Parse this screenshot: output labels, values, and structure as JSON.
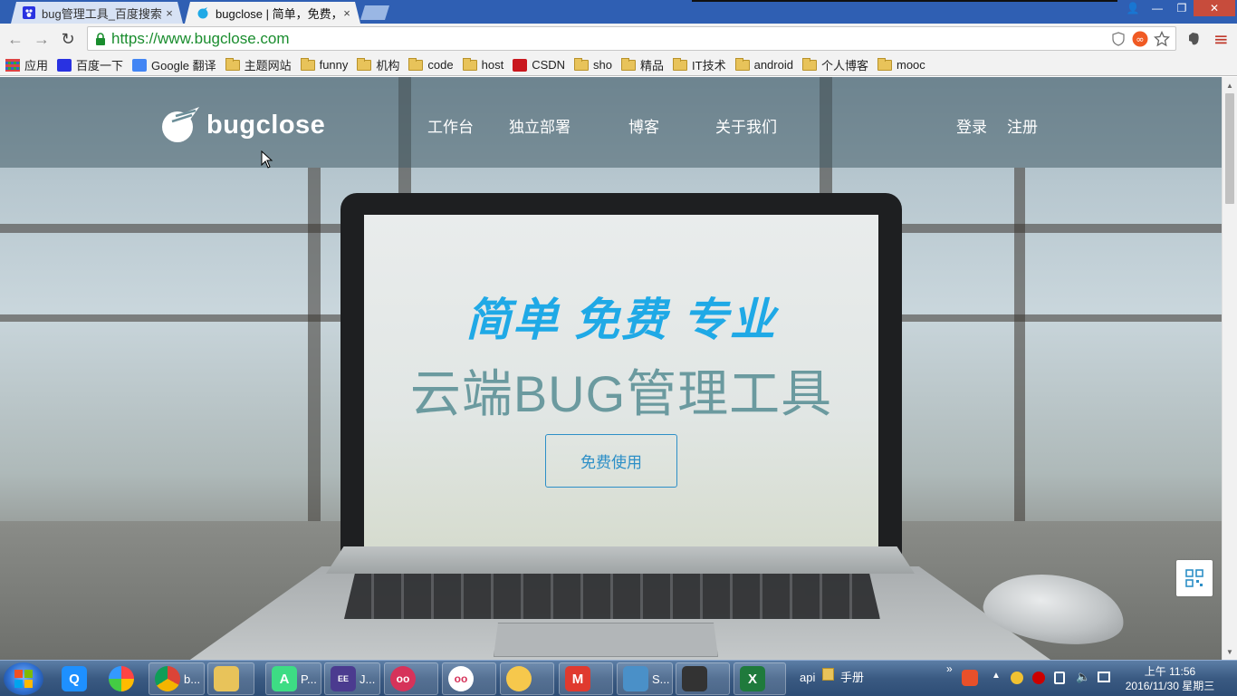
{
  "browser": {
    "tabs": [
      {
        "title": "bug管理工具_百度搜索",
        "close": "×"
      },
      {
        "title": "bugclose | 简单，免费，",
        "close": "×"
      }
    ],
    "url": "https://www.bugclose.com",
    "window_controls": {
      "user": "👤",
      "minimize": "—",
      "restore": "❐",
      "close": "✕"
    },
    "nav": {
      "back": "←",
      "forward": "→",
      "reload": "↻"
    },
    "menu": "≡"
  },
  "bookmarks": [
    {
      "label": "应用",
      "icon": "apps-grid-icon"
    },
    {
      "label": "百度一下",
      "icon": "baidu-icon"
    },
    {
      "label": "Google 翻译",
      "icon": "translate-icon"
    },
    {
      "label": "主题网站",
      "icon": "folder-icon"
    },
    {
      "label": "funny",
      "icon": "folder-icon"
    },
    {
      "label": "机构",
      "icon": "folder-icon"
    },
    {
      "label": "code",
      "icon": "folder-icon"
    },
    {
      "label": "host",
      "icon": "folder-icon"
    },
    {
      "label": "CSDN",
      "icon": "csdn-icon"
    },
    {
      "label": "sho",
      "icon": "folder-icon"
    },
    {
      "label": "精品",
      "icon": "folder-icon"
    },
    {
      "label": "IT技术",
      "icon": "folder-icon"
    },
    {
      "label": "android",
      "icon": "folder-icon"
    },
    {
      "label": "个人博客",
      "icon": "folder-icon"
    },
    {
      "label": "mooc",
      "icon": "folder-icon"
    }
  ],
  "site": {
    "logo_text": "bugclose",
    "nav": [
      "工作台",
      "独立部署",
      "博客",
      "关于我们"
    ],
    "login": "登录",
    "register": "注册",
    "headline": "简单 免费 专业",
    "subheadline": "云端BUG管理工具",
    "cta": "免费使用"
  },
  "taskbar": {
    "items": [
      {
        "label": "b...",
        "color": "#dd4b39"
      },
      {
        "label": "P...",
        "color": "#3ddc84"
      },
      {
        "label": "J...",
        "color": "#4b3b8f"
      },
      {
        "label": "S...",
        "color": "#4a90c8"
      }
    ],
    "api_label": "api",
    "folder_label": "手册",
    "expand": "»",
    "clock_time": "上午 11:56",
    "clock_date": "2016/11/30 星期三"
  },
  "colors": {
    "headline": "#1fa9e6",
    "subheadline": "#6b9a9f",
    "cta": "#2d8fc7",
    "url": "#1a8d2e",
    "tabstrip": "#2f5fb3"
  }
}
